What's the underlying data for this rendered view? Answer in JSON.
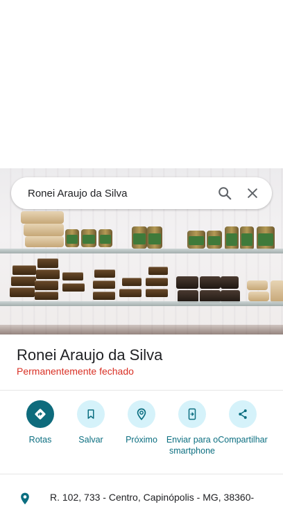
{
  "search": {
    "value": "Ronei Araujo da Silva"
  },
  "icons": {
    "search": "search-icon",
    "close": "close-icon",
    "location": "location-pin-icon"
  },
  "place": {
    "name": "Ronei Araujo da Silva",
    "status": "Permanentemente fechado"
  },
  "actions": [
    {
      "label": "Rotas",
      "icon": "directions-icon"
    },
    {
      "label": "Salvar",
      "icon": "bookmark-icon"
    },
    {
      "label": "Próximo",
      "icon": "nearby-icon"
    },
    {
      "label": "Enviar para o smartphone",
      "icon": "send-to-phone-icon"
    },
    {
      "label": "Compartilhar",
      "icon": "share-icon"
    }
  ],
  "address": "R. 102, 733 - Centro, Capinópolis - MG, 38360-",
  "colors": {
    "accent": "#0e6b7c",
    "accent_light": "#d5f2fa",
    "closed": "#d93025"
  }
}
